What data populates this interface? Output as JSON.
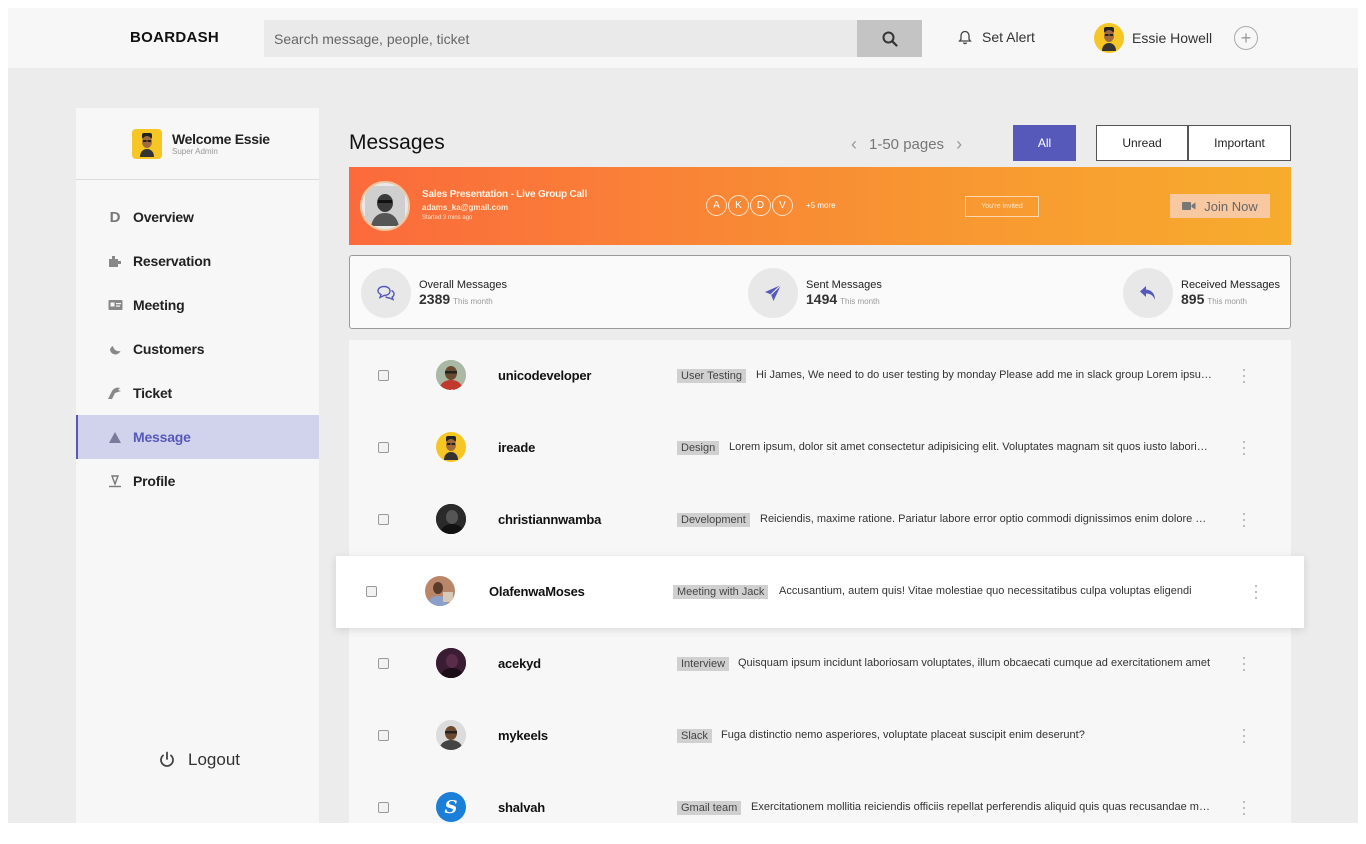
{
  "header": {
    "brand": "BOARDASH",
    "search_placeholder": "Search message, people, ticket",
    "alert_label": "Set Alert",
    "user_name": "Essie Howell"
  },
  "sidebar": {
    "welcome_title": "Welcome Essie",
    "welcome_role": "Super Admin",
    "items": [
      {
        "label": "Overview",
        "icon": "d-letter-icon"
      },
      {
        "label": "Reservation",
        "icon": "puzzle-icon"
      },
      {
        "label": "Meeting",
        "icon": "id-card-icon"
      },
      {
        "label": "Customers",
        "icon": "moon-icon"
      },
      {
        "label": "Ticket",
        "icon": "ticket-icon"
      },
      {
        "label": "Message",
        "icon": "triangle-icon",
        "active": true
      },
      {
        "label": "Profile",
        "icon": "profile-icon"
      }
    ],
    "logout_label": "Logout"
  },
  "main": {
    "title": "Messages",
    "pager_label": "1-50 pages",
    "tabs": [
      {
        "label": "All",
        "active": true
      },
      {
        "label": "Unread"
      },
      {
        "label": "Important"
      }
    ]
  },
  "banner": {
    "title": "Sales Presentation - Live Group Call",
    "email": "adams_ka@gmail.com",
    "time": "Started 3 mins ago",
    "participants": [
      "A",
      "K",
      "D",
      "V"
    ],
    "more": "+5 more",
    "invited": "You're invited",
    "join_label": "Join Now"
  },
  "stats": [
    {
      "label": "Overall Messages",
      "value": "2389",
      "sub": "This month",
      "icon": "chat-bubbles-icon"
    },
    {
      "label": "Sent Messages",
      "value": "1494",
      "sub": "This month",
      "icon": "send-icon"
    },
    {
      "label": "Received Messages",
      "value": "895",
      "sub": "This month",
      "icon": "reply-icon"
    }
  ],
  "messages": [
    {
      "user": "unicodeveloper",
      "tag": "User Testing",
      "text": "Hi James, We need to do user testing by monday Please add me in slack group Lorem ipsum dolor sit amet"
    },
    {
      "user": "ireade",
      "tag": "Design",
      "text": "Lorem ipsum, dolor sit amet consectetur adipisicing elit. Voluptates magnam sit quos iusto laboriosam"
    },
    {
      "user": "christiannwamba",
      "tag": "Development",
      "text": "Reiciendis, maxime ratione. Pariatur labore error optio commodi dignissimos enim dolore quas"
    },
    {
      "user": "OlafenwaMoses",
      "tag": "Meeting with Jack",
      "text": "Accusantium, autem quis! Vitae molestiae quo necessitatibus culpa voluptas eligendi"
    },
    {
      "user": "acekyd",
      "tag": "Interview",
      "text": "Quisquam ipsum incidunt laboriosam voluptates, illum obcaecati cumque ad exercitationem amet"
    },
    {
      "user": "mykeels",
      "tag": "Slack",
      "text": "Fuga distinctio nemo asperiores, voluptate placeat suscipit enim deserunt?"
    },
    {
      "user": "shalvah",
      "tag": "Gmail team",
      "text": "Exercitationem mollitia reiciendis officiis repellat perferendis aliquid quis quas recusandae minima"
    }
  ]
}
